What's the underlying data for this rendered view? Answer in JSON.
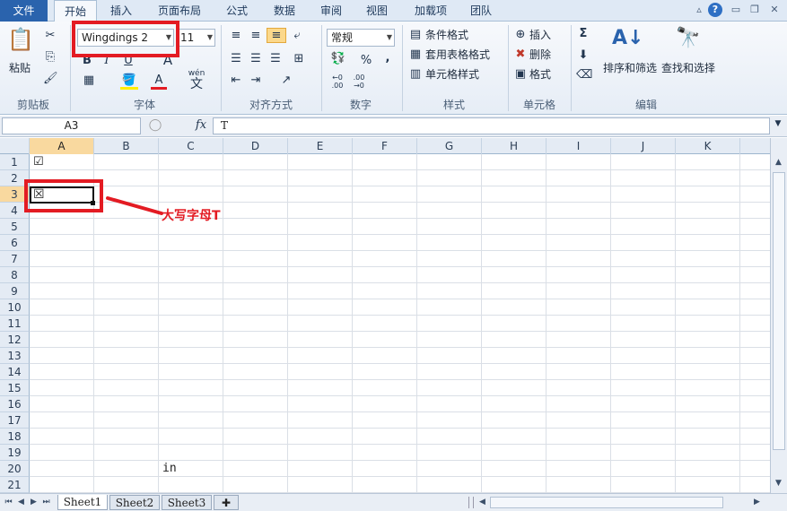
{
  "tabs": {
    "file": "文件",
    "home": "开始",
    "insert": "插入",
    "page_layout": "页面布局",
    "formulas": "公式",
    "data": "数据",
    "review": "审阅",
    "view": "视图",
    "addins": "加载项",
    "team": "团队"
  },
  "clipboard": {
    "paste": "粘贴",
    "group": "剪贴板"
  },
  "font": {
    "name": "Wingdings 2",
    "size": "11",
    "bold": "B",
    "italic": "I",
    "underline": "U",
    "grow": "A",
    "color": "A",
    "phonetic": "wén",
    "phonetic_char": "文",
    "group": "字体"
  },
  "alignment": {
    "group": "对齐方式"
  },
  "number": {
    "format": "常规",
    "percent": "%",
    "comma": ",",
    "inc": "+.0\n.00",
    "dec": ".00\n+.0",
    "group": "数字"
  },
  "styles": {
    "conditional": "条件格式",
    "table": "套用表格格式",
    "cell": "单元格样式",
    "group": "样式"
  },
  "cells_group": {
    "insert": "插入",
    "delete": "删除",
    "format": "格式",
    "group": "单元格"
  },
  "editing": {
    "sort": "排序和筛选",
    "find": "查找和选择",
    "group": "编辑"
  },
  "formula_bar": {
    "namebox": "A3",
    "fx": "fx",
    "content": "T"
  },
  "columns": [
    "A",
    "B",
    "C",
    "D",
    "E",
    "F",
    "G",
    "H",
    "I",
    "J",
    "K"
  ],
  "rows": [
    "1",
    "2",
    "3",
    "4",
    "5",
    "6",
    "7",
    "8",
    "9",
    "10",
    "11",
    "12",
    "13",
    "14",
    "15",
    "16",
    "17",
    "18",
    "19",
    "20",
    "21"
  ],
  "cell_values": {
    "A1": "☑",
    "A3": "☒",
    "C20": "in"
  },
  "annotation": "大写字母T",
  "sheets": [
    "Sheet1",
    "Sheet2",
    "Sheet3"
  ],
  "colors": {
    "accent_red": "#e31b23",
    "file_tab": "#2a63ad",
    "selected_header": "#f9d99f"
  }
}
